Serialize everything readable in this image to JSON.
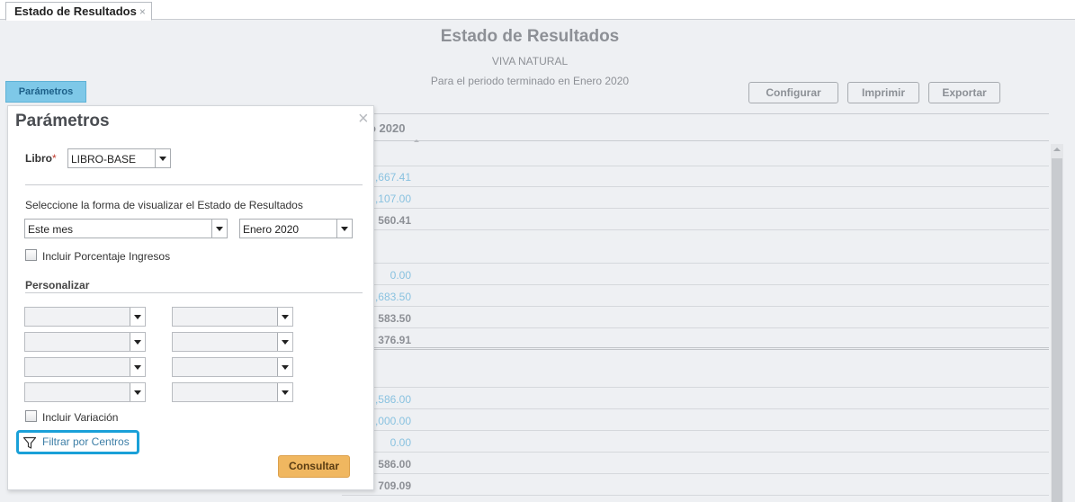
{
  "tab": {
    "label": "Estado de Resultados",
    "close": "×"
  },
  "report": {
    "title": "Estado de Resultados",
    "company": "VIVA NATURAL",
    "period": "Para el periodo terminado en Enero 2020",
    "parametros_button": "Parámetros",
    "toolbar": {
      "configurar": "Configurar",
      "imprimir": "Imprimir",
      "exportar": "Exportar"
    },
    "column_header": "o 2020",
    "rows": [
      {
        "value": "",
        "style": "blank"
      },
      {
        "value": ",667.41",
        "style": "link"
      },
      {
        "value": ",107.00",
        "style": "link"
      },
      {
        "value": "560.41",
        "style": "bold"
      },
      {
        "value": "",
        "style": "blank"
      },
      {
        "value": "0.00",
        "style": "link"
      },
      {
        "value": ",683.50",
        "style": "link"
      },
      {
        "value": "583.50",
        "style": "bold"
      },
      {
        "value": "376.91",
        "style": "bold"
      },
      {
        "value": "",
        "style": "blank"
      },
      {
        "value": ",586.00",
        "style": "link"
      },
      {
        "value": ",000.00",
        "style": "link"
      },
      {
        "value": "0.00",
        "style": "link"
      },
      {
        "value": "586.00",
        "style": "bold"
      },
      {
        "value": "709.09",
        "style": "bold"
      }
    ]
  },
  "panel": {
    "title": "Parámetros",
    "close": "×",
    "libro_label": "Libro",
    "libro_required": "*",
    "libro_value": "LIBRO-BASE",
    "visualizar_label": "Seleccione la forma de visualizar el Estado de Resultados",
    "mode_value": "Este mes",
    "period_value": "Enero 2020",
    "incluir_porcentaje": "Incluir Porcentaje Ingresos",
    "personalizar": "Personalizar",
    "incluir_variacion": "Incluir Variación",
    "filtrar_centros": "Filtrar por Centros",
    "consultar": "Consultar"
  },
  "colors": {
    "accent": "#1aa0d8",
    "consultar": "#f0b760",
    "link": "#89c2e0"
  },
  "icons": [
    "close-icon",
    "filter-icon",
    "chevron-down-icon",
    "checkbox-icon"
  ]
}
